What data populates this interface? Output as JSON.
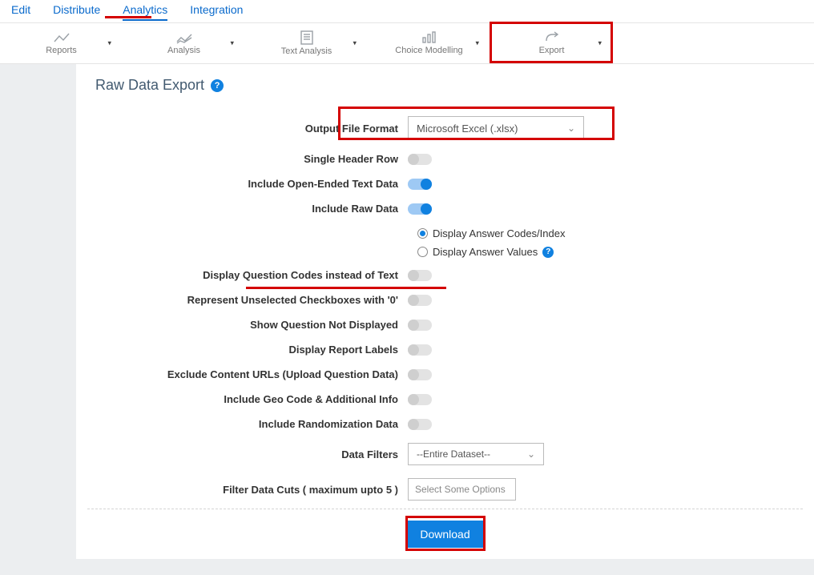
{
  "topnav": {
    "edit": "Edit",
    "distribute": "Distribute",
    "analytics": "Analytics",
    "integration": "Integration"
  },
  "toolbar": {
    "reports": "Reports",
    "analysis": "Analysis",
    "text_analysis": "Text Analysis",
    "choice_modelling": "Choice Modelling",
    "export": "Export"
  },
  "page": {
    "title": "Raw Data Export"
  },
  "form": {
    "output_format_label": "Output File Format",
    "output_format_value": "Microsoft Excel (.xlsx)",
    "single_header": "Single Header Row",
    "open_ended": "Include Open-Ended Text Data",
    "raw_data": "Include Raw Data",
    "radio_codes": "Display Answer Codes/Index",
    "radio_values": "Display Answer Values",
    "q_codes": "Display Question Codes instead of Text",
    "unselected": "Represent Unselected Checkboxes with '0'",
    "not_displayed": "Show Question Not Displayed",
    "report_labels": "Display Report Labels",
    "exclude_urls": "Exclude Content URLs (Upload Question Data)",
    "geo": "Include Geo Code & Additional Info",
    "random": "Include Randomization Data",
    "filters_label": "Data Filters",
    "filters_value": "--Entire Dataset--",
    "cuts_label": "Filter Data Cuts ( maximum upto 5 )",
    "cuts_placeholder": "Select Some Options",
    "download": "Download"
  }
}
